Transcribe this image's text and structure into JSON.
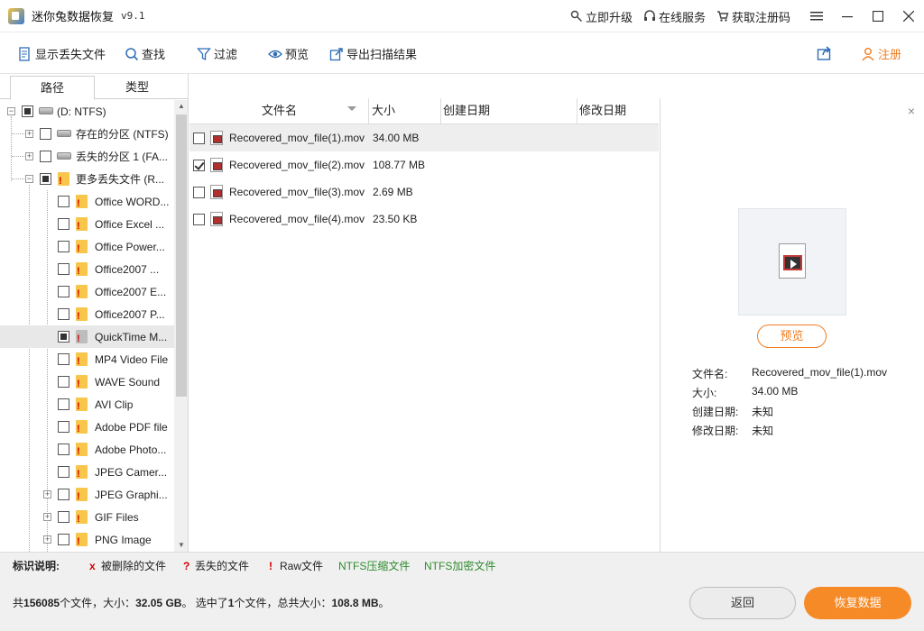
{
  "app": {
    "title": "迷你兔数据恢复",
    "version": "v9.1",
    "actions": {
      "upgrade": "立即升级",
      "online_service": "在线服务",
      "get_code": "获取注册码"
    }
  },
  "toolbar": {
    "show_lost": "显示丢失文件",
    "find": "查找",
    "filter": "过滤",
    "preview": "预览",
    "export": "导出扫描结果",
    "register": "注册"
  },
  "tabs": {
    "path": "路径",
    "type": "类型"
  },
  "tree": {
    "root": "(D: NTFS)",
    "items": [
      {
        "label": "存在的分区 (NTFS)",
        "state": "unchecked",
        "icon": "drive-icon"
      },
      {
        "label": "丢失的分区 1 (FA...",
        "state": "unchecked",
        "icon": "drive-icon"
      },
      {
        "label": "更多丢失文件 (R...",
        "state": "partial",
        "icon": "folder-icon"
      }
    ],
    "children": [
      {
        "label": "Office WORD...",
        "state": "unchecked"
      },
      {
        "label": "Office Excel ...",
        "state": "unchecked"
      },
      {
        "label": "Office Power...",
        "state": "unchecked"
      },
      {
        "label": "Office2007 ...",
        "state": "unchecked"
      },
      {
        "label": "Office2007 E...",
        "state": "unchecked"
      },
      {
        "label": "Office2007 P...",
        "state": "unchecked"
      },
      {
        "label": "QuickTime M...",
        "state": "partial"
      },
      {
        "label": "MP4 Video File",
        "state": "unchecked"
      },
      {
        "label": "WAVE Sound",
        "state": "unchecked"
      },
      {
        "label": "AVI Clip",
        "state": "unchecked"
      },
      {
        "label": "Adobe PDF file",
        "state": "unchecked"
      },
      {
        "label": "Adobe Photo...",
        "state": "unchecked"
      },
      {
        "label": "JPEG Camer...",
        "state": "unchecked"
      },
      {
        "label": "JPEG Graphi...",
        "state": "unchecked"
      },
      {
        "label": "GIF Files",
        "state": "unchecked"
      },
      {
        "label": "PNG Image",
        "state": "unchecked"
      }
    ]
  },
  "file_list": {
    "columns": {
      "name": "文件名",
      "size": "大小",
      "created": "创建日期",
      "modified": "修改日期"
    },
    "rows": [
      {
        "name": "Recovered_mov_file(1).mov",
        "size": "34.00 MB",
        "checked": false
      },
      {
        "name": "Recovered_mov_file(2).mov",
        "size": "108.77 MB",
        "checked": true
      },
      {
        "name": "Recovered_mov_file(3).mov",
        "size": "2.69 MB",
        "checked": false
      },
      {
        "name": "Recovered_mov_file(4).mov",
        "size": "23.50 KB",
        "checked": false
      }
    ]
  },
  "preview": {
    "button": "预览",
    "labels": {
      "name": "文件名:",
      "size": "大小:",
      "created": "创建日期:",
      "modified": "修改日期:"
    },
    "values": {
      "name": "Recovered_mov_file(1).mov",
      "size": "34.00 MB",
      "created": "未知",
      "modified": "未知"
    }
  },
  "legend": {
    "title": "标识说明:",
    "deleted": "被删除的文件",
    "lost": "丢失的文件",
    "raw": "Raw文件",
    "ntfs_compressed": "NTFS压缩文件",
    "ntfs_encrypted": "NTFS加密文件",
    "colors": {
      "deleted": "#d40000",
      "lost": "#d40000",
      "raw": "#d40000",
      "ntfs": "#2e8b2e"
    }
  },
  "status": {
    "prefix": "共",
    "total_files": "156085",
    "files_size_sep": "个文件，大小：",
    "total_size": "32.05 GB",
    "selected_sep": "。 选中了",
    "selected_count": "1",
    "selected_files_sep": "个文件，总共大小：",
    "selected_size": "108.8 MB",
    "suffix": "。"
  },
  "buttons": {
    "back": "返回",
    "recover": "恢复数据"
  },
  "colors": {
    "accent": "#f58a27"
  }
}
